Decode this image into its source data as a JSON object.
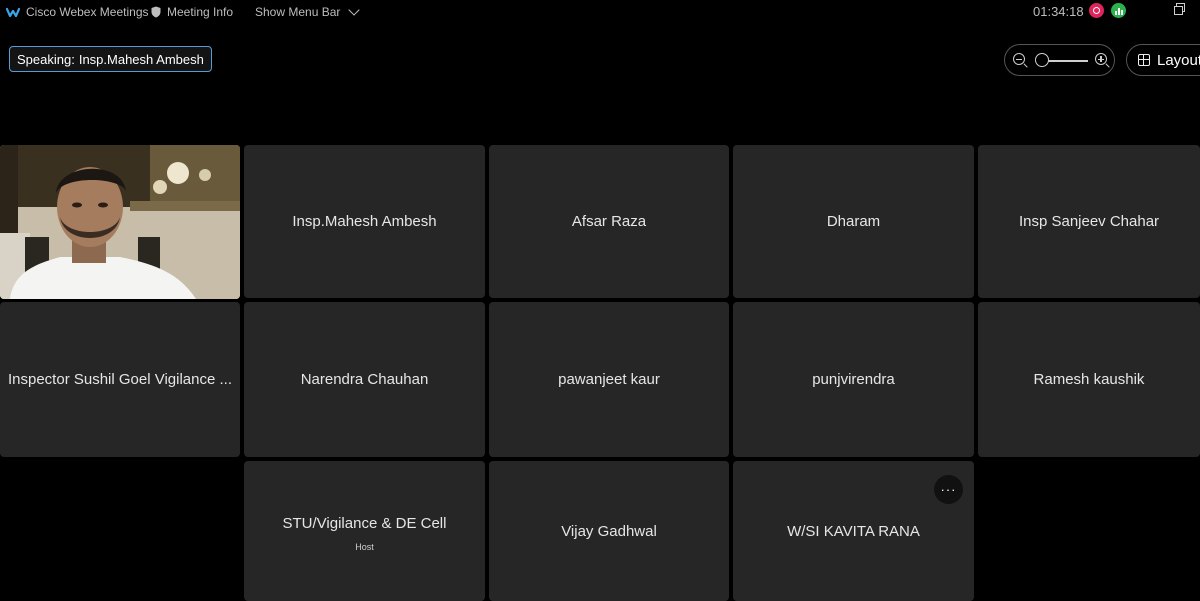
{
  "titlebar": {
    "app_name": "Cisco Webex Meetings",
    "meeting_info": "Meeting Info",
    "show_menu_bar": "Show Menu Bar",
    "clock": "01:34:18"
  },
  "speaking": {
    "prefix": "Speaking:",
    "name": "Insp.Mahesh Ambesh"
  },
  "layout": {
    "label": "Layout"
  },
  "participants": [
    {
      "name": "Insp.Mahesh Ambesh"
    },
    {
      "name": "Afsar Raza"
    },
    {
      "name": "Dharam"
    },
    {
      "name": "Insp Sanjeev Chahar"
    },
    {
      "name": "Inspector Sushil Goel Vigilance ..."
    },
    {
      "name": "Narendra Chauhan"
    },
    {
      "name": "pawanjeet kaur"
    },
    {
      "name": "punjvirendra"
    },
    {
      "name": "Ramesh kaushik"
    },
    {
      "name": "STU/Vigilance & DE Cell",
      "role": "Host"
    },
    {
      "name": "Vijay Gadhwal"
    },
    {
      "name": "W/SI KAVITA RANA"
    }
  ],
  "more_options": "···",
  "colors": {
    "accent": "#5a9bd5",
    "tile_bg": "#262626",
    "background": "#000000"
  }
}
